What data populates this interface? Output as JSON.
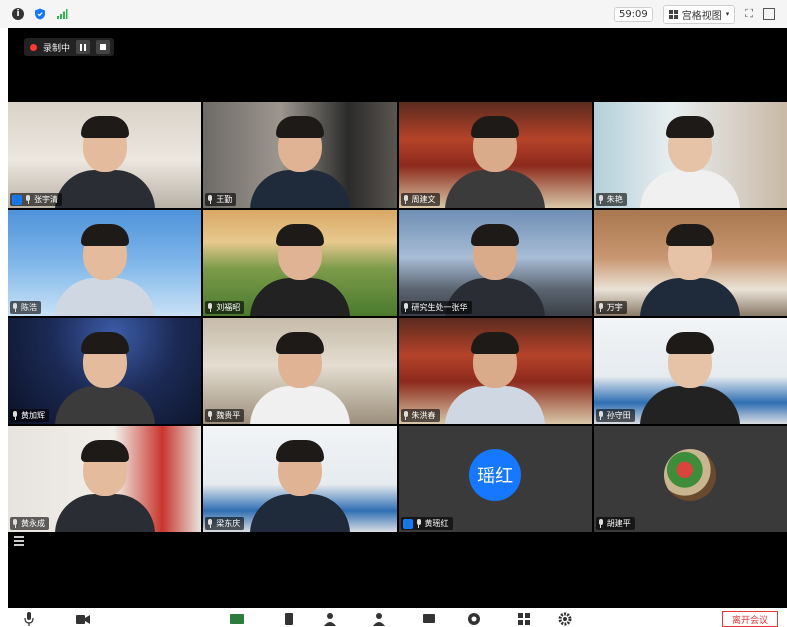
{
  "topbar": {
    "timer": "59:09",
    "view_label": "宫格视图"
  },
  "recording": {
    "label": "录制中"
  },
  "participants": [
    {
      "name": "张宇清",
      "host": true,
      "mic": true,
      "bg": "office-white"
    },
    {
      "name": "王勤",
      "host": false,
      "mic": true,
      "bg": "room-gray"
    },
    {
      "name": "周建文",
      "host": false,
      "mic": true,
      "bg": "hall-red"
    },
    {
      "name": "朱艳",
      "host": false,
      "mic": true,
      "bg": "room-window"
    },
    {
      "name": "陈浩",
      "host": false,
      "mic": true,
      "bg": "sky-blue"
    },
    {
      "name": "刘福昭",
      "host": false,
      "mic": true,
      "bg": "meadow"
    },
    {
      "name": "研究生处一张华",
      "host": false,
      "mic": true,
      "bg": "city"
    },
    {
      "name": "万宇",
      "host": false,
      "mic": true,
      "bg": "cabinet"
    },
    {
      "name": "黄加辉",
      "host": false,
      "mic": true,
      "bg": "star-trails"
    },
    {
      "name": "魏贵平",
      "host": false,
      "mic": true,
      "bg": "shelves"
    },
    {
      "name": "朱洪春",
      "host": false,
      "mic": true,
      "bg": "hall-red"
    },
    {
      "name": "孙守田",
      "host": false,
      "mic": true,
      "bg": "office-blue"
    },
    {
      "name": "黄永成",
      "host": false,
      "mic": true,
      "bg": "office-red"
    },
    {
      "name": "梁东庆",
      "host": false,
      "mic": true,
      "bg": "office-blue"
    },
    {
      "name": "黄瑶红",
      "host": true,
      "mic": true,
      "avatar_text": "瑶红",
      "bg": "none"
    },
    {
      "name": "胡建平",
      "host": false,
      "mic": true,
      "avatar_photo": true,
      "bg": "none"
    }
  ],
  "toolbar": {
    "leave_label": "离开会议"
  },
  "colors": {
    "accent": "#1677ff",
    "recording": "#ff3b30",
    "leave": "#e53935"
  }
}
